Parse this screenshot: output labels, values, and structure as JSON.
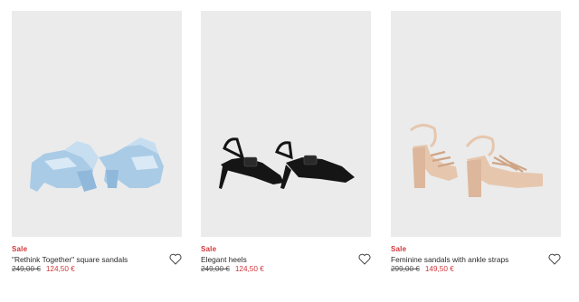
{
  "products": [
    {
      "badge": "Sale",
      "name": "\"Rethink Together\" square sandals",
      "old_price": "249,00 €",
      "new_price": "124,50 €",
      "image_icon": "blue-mule-sandals-image",
      "shoe_color": "#a9cbe6"
    },
    {
      "badge": "Sale",
      "name": "Elegant heels",
      "old_price": "249,00 €",
      "new_price": "124,50 €",
      "image_icon": "black-slingback-heels-image",
      "shoe_color": "#151515"
    },
    {
      "badge": "Sale",
      "name": "Feminine sandals with ankle straps",
      "old_price": "299,00 €",
      "new_price": "149,50 €",
      "image_icon": "beige-platform-sandals-image",
      "shoe_color": "#e6c7ae"
    }
  ],
  "colors": {
    "sale": "#d1353a",
    "image_bg": "#ebebeb"
  },
  "icons": {
    "wishlist": "heart-outline-icon"
  }
}
